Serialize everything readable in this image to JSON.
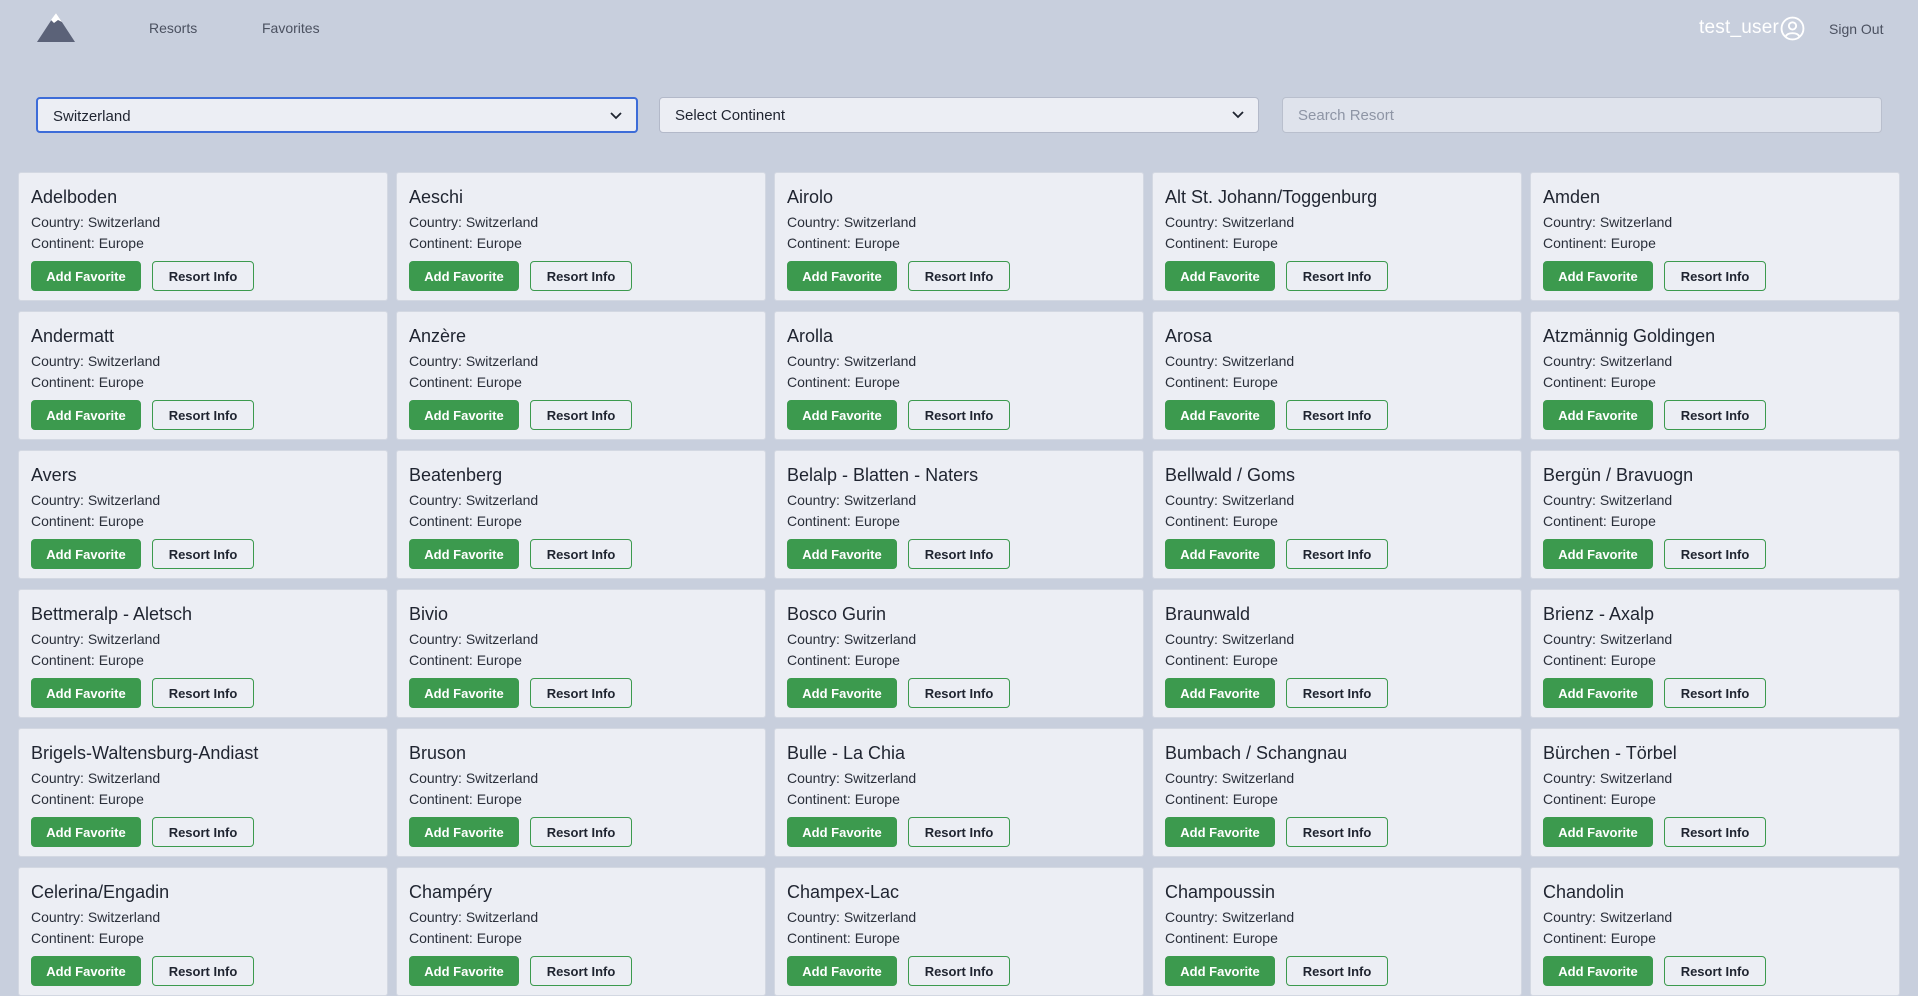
{
  "nav": {
    "links": [
      "Resorts",
      "Favorites"
    ],
    "username": "test_user",
    "signout": "Sign Out"
  },
  "filters": {
    "country_value": "Switzerland",
    "continent_value": "Select Continent",
    "search_placeholder": "Search Resort"
  },
  "colors": {
    "accent_green": "#3c9a4e",
    "page_bg": "#c8cfdd",
    "card_bg": "#eceef4",
    "focus_blue": "#3d6cd8"
  },
  "card_labels": {
    "country_prefix": "Country: ",
    "continent_prefix": "Continent: ",
    "add_favorite": "Add Favorite",
    "resort_info": "Resort Info"
  },
  "resorts": [
    {
      "name": "Adelboden",
      "country": "Switzerland",
      "continent": "Europe"
    },
    {
      "name": "Aeschi",
      "country": "Switzerland",
      "continent": "Europe"
    },
    {
      "name": "Airolo",
      "country": "Switzerland",
      "continent": "Europe"
    },
    {
      "name": "Alt St. Johann/Toggenburg",
      "country": "Switzerland",
      "continent": "Europe"
    },
    {
      "name": "Amden",
      "country": "Switzerland",
      "continent": "Europe"
    },
    {
      "name": "Andermatt",
      "country": "Switzerland",
      "continent": "Europe"
    },
    {
      "name": "Anzère",
      "country": "Switzerland",
      "continent": "Europe"
    },
    {
      "name": "Arolla",
      "country": "Switzerland",
      "continent": "Europe"
    },
    {
      "name": "Arosa",
      "country": "Switzerland",
      "continent": "Europe"
    },
    {
      "name": "Atzmännig Goldingen",
      "country": "Switzerland",
      "continent": "Europe"
    },
    {
      "name": "Avers",
      "country": "Switzerland",
      "continent": "Europe"
    },
    {
      "name": "Beatenberg",
      "country": "Switzerland",
      "continent": "Europe"
    },
    {
      "name": "Belalp - Blatten - Naters",
      "country": "Switzerland",
      "continent": "Europe"
    },
    {
      "name": "Bellwald / Goms",
      "country": "Switzerland",
      "continent": "Europe"
    },
    {
      "name": "Bergün / Bravuogn",
      "country": "Switzerland",
      "continent": "Europe"
    },
    {
      "name": "Bettmeralp - Aletsch",
      "country": "Switzerland",
      "continent": "Europe"
    },
    {
      "name": "Bivio",
      "country": "Switzerland",
      "continent": "Europe"
    },
    {
      "name": "Bosco Gurin",
      "country": "Switzerland",
      "continent": "Europe"
    },
    {
      "name": "Braunwald",
      "country": "Switzerland",
      "continent": "Europe"
    },
    {
      "name": "Brienz - Axalp",
      "country": "Switzerland",
      "continent": "Europe"
    },
    {
      "name": "Brigels-Waltensburg-Andiast",
      "country": "Switzerland",
      "continent": "Europe"
    },
    {
      "name": "Bruson",
      "country": "Switzerland",
      "continent": "Europe"
    },
    {
      "name": "Bulle - La Chia",
      "country": "Switzerland",
      "continent": "Europe"
    },
    {
      "name": "Bumbach / Schangnau",
      "country": "Switzerland",
      "continent": "Europe"
    },
    {
      "name": "Bürchen - Törbel",
      "country": "Switzerland",
      "continent": "Europe"
    },
    {
      "name": "Celerina/Engadin",
      "country": "Switzerland",
      "continent": "Europe"
    },
    {
      "name": "Champéry",
      "country": "Switzerland",
      "continent": "Europe"
    },
    {
      "name": "Champex-Lac",
      "country": "Switzerland",
      "continent": "Europe"
    },
    {
      "name": "Champoussin",
      "country": "Switzerland",
      "continent": "Europe"
    },
    {
      "name": "Chandolin",
      "country": "Switzerland",
      "continent": "Europe"
    }
  ]
}
